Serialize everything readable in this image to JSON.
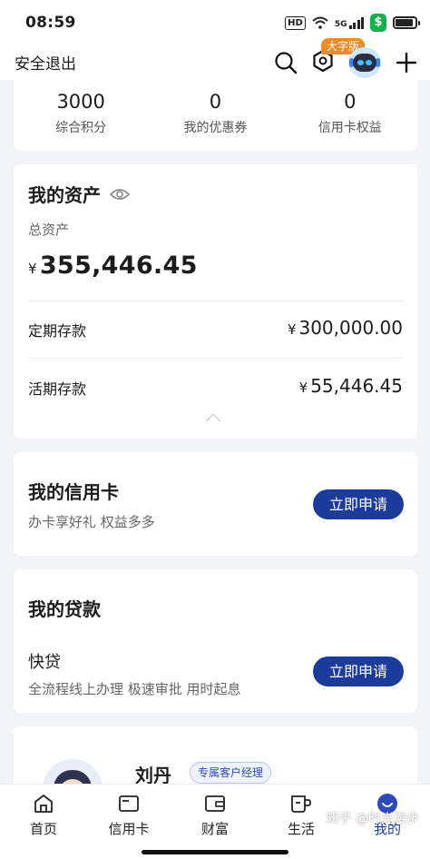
{
  "status_bar": {
    "time": "08:59",
    "hd": "HD",
    "network": "5G"
  },
  "header": {
    "logout": "安全退出",
    "big_font_tag": "大字版"
  },
  "stats": [
    {
      "value": "3000",
      "label": "综合积分"
    },
    {
      "value": "0",
      "label": "我的优惠券"
    },
    {
      "value": "0",
      "label": "信用卡权益"
    }
  ],
  "assets": {
    "title": "我的资产",
    "total_label": "总资产",
    "currency": "¥",
    "total": "355,446.45",
    "rows": [
      {
        "label": "定期存款",
        "value": "300,000.00"
      },
      {
        "label": "活期存款",
        "value": "55,446.45"
      }
    ]
  },
  "credit_card": {
    "title": "我的信用卡",
    "subtitle": "办卡享好礼 权益多多",
    "button": "立即申请"
  },
  "loan": {
    "title": "我的贷款",
    "product": "快贷",
    "subtitle": "全流程线上办理 极速审批 用时起息",
    "button": "立即申请"
  },
  "manager": {
    "name": "刘丹",
    "badge": "专属客户经理"
  },
  "tabbar": [
    {
      "label": "首页",
      "icon": "home-icon"
    },
    {
      "label": "信用卡",
      "icon": "card-icon"
    },
    {
      "label": "财富",
      "icon": "wallet-icon"
    },
    {
      "label": "生活",
      "icon": "cup-icon"
    },
    {
      "label": "我的",
      "icon": "smile-icon",
      "active": true
    }
  ],
  "watermark": "知乎 @时光漫步",
  "colors": {
    "brand_blue": "#1d3b9a",
    "tag_orange": "#f08a24",
    "background": "#f3f4f7"
  }
}
